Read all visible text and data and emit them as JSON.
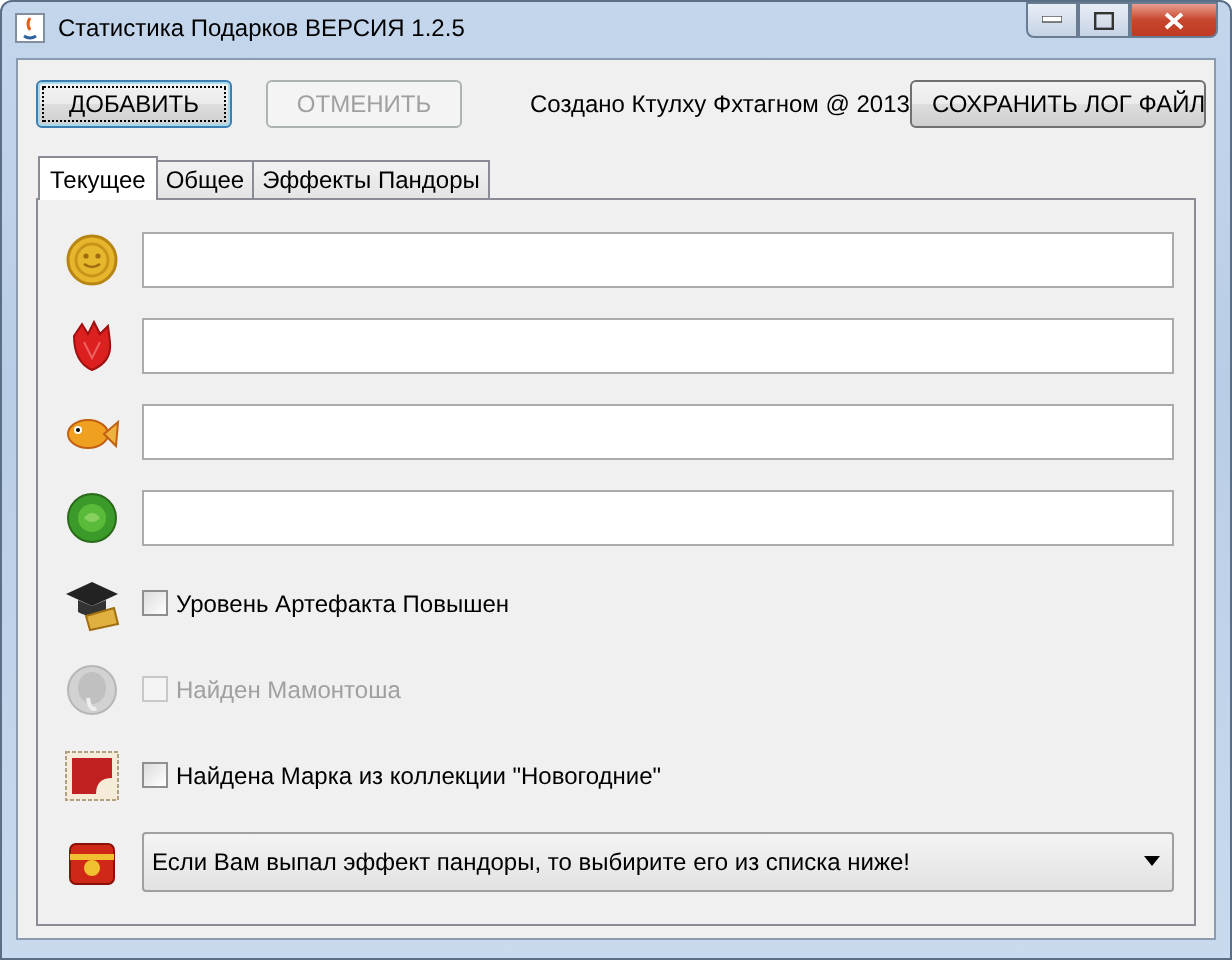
{
  "window": {
    "title": "Статистика Подарков ВЕРСИЯ 1.2.5"
  },
  "toolbar": {
    "buttons": [
      {
        "label": "ДОБАВИТЬ",
        "disabled": false,
        "focused": true
      },
      {
        "label": "ОТМЕНИТЬ",
        "disabled": true,
        "focused": false
      }
    ],
    "credit": "Создано Ктулху Фхтагном @ 2013",
    "save_button": "СОХРАНИТЬ ЛОГ ФАЙЛ"
  },
  "tabs": [
    {
      "label": "Текущее",
      "selected": true
    },
    {
      "label": "Общее",
      "selected": false
    },
    {
      "label": "Эффекты Пандоры",
      "selected": false
    }
  ],
  "rows": [
    {
      "kind": "field"
    },
    {
      "kind": "field"
    },
    {
      "kind": "field"
    },
    {
      "kind": "field"
    },
    {
      "kind": "checkbox",
      "label": "Уровень Артефакта Повышен",
      "checked": false,
      "disabled": false
    },
    {
      "kind": "checkbox",
      "label": "Найден Мамонтоша",
      "checked": false,
      "disabled": true
    },
    {
      "kind": "checkbox",
      "label": "Найдена Марка из коллекции \"Новогодние\"",
      "checked": false,
      "disabled": false
    },
    {
      "kind": "dropdown",
      "value": "Если Вам выпал эффект пандоры, то выбирите его из списка ниже!"
    }
  ]
}
